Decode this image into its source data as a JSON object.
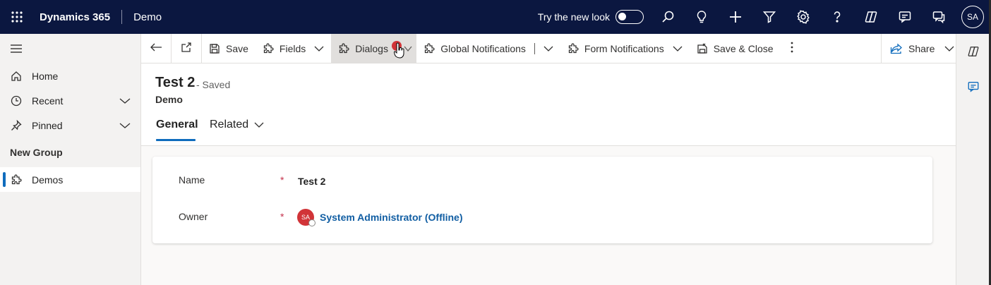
{
  "topbar": {
    "app_title": "Dynamics 365",
    "environment": "Demo",
    "new_look_label": "Try the new look",
    "avatar_initials": "SA"
  },
  "nav": {
    "items": [
      {
        "label": "Home"
      },
      {
        "label": "Recent"
      },
      {
        "label": "Pinned"
      }
    ],
    "group_label": "New Group",
    "group_items": [
      {
        "label": "Demos"
      }
    ]
  },
  "commandbar": {
    "save": "Save",
    "fields": "Fields",
    "dialogs": "Dialogs",
    "global_notifications": "Global Notifications",
    "form_notifications": "Form Notifications",
    "save_close": "Save & Close",
    "share": "Share"
  },
  "record": {
    "title": "Test 2",
    "status": "- Saved",
    "entity": "Demo",
    "tabs": [
      {
        "label": "General"
      },
      {
        "label": "Related"
      }
    ]
  },
  "form": {
    "name_label": "Name",
    "name_value": "Test 2",
    "owner_label": "Owner",
    "owner_value": "System Administrator (Offline)",
    "owner_initials": "SA",
    "required_mark": "*"
  },
  "colors": {
    "topbar": "#0b1740",
    "accent": "#0f6cbd",
    "link": "#115ea3",
    "required": "#c4314b",
    "badge": "#d13438"
  }
}
